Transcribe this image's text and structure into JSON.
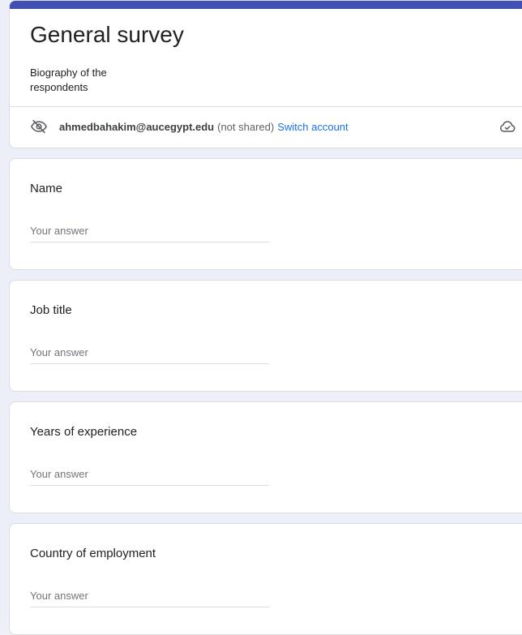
{
  "form": {
    "title": "General survey",
    "description": "Biography of the respondents",
    "accent_color": "#3f51b5"
  },
  "account": {
    "email": "ahmedbahakim@aucegypt.edu",
    "shared_status": "(not shared)",
    "switch_label": "Switch account",
    "privacy_icon": "eye-off-icon",
    "save_icon": "cloud-check-icon",
    "link_color": "#1a73e8"
  },
  "questions": [
    {
      "label": "Name",
      "placeholder": "Your answer"
    },
    {
      "label": "Job title",
      "placeholder": "Your answer"
    },
    {
      "label": "Years of experience",
      "placeholder": "Your answer"
    },
    {
      "label": "Country of employment",
      "placeholder": "Your answer"
    }
  ]
}
